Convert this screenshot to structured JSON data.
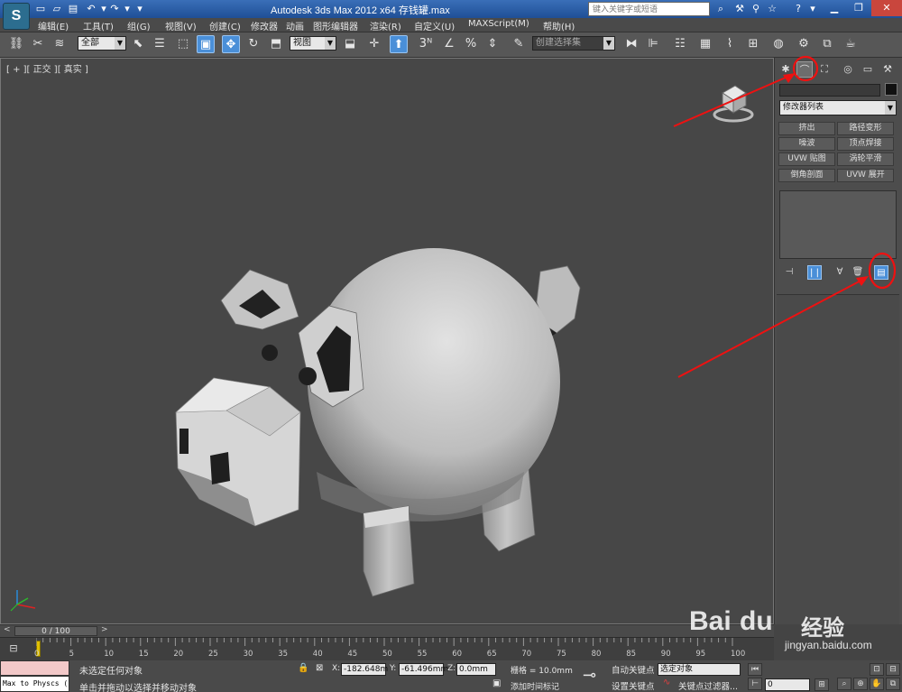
{
  "app": {
    "title": "Autodesk 3ds Max  2012 x64      存钱罐.max",
    "logo_letter": "S",
    "search_placeholder": "键入关键字或短语"
  },
  "menu": [
    "编辑(E)",
    "工具(T)",
    "组(G)",
    "视图(V)",
    "创建(C)",
    "修改器",
    "动画",
    "图形编辑器",
    "渲染(R)",
    "自定义(U)",
    "MAXScript(M)",
    "帮助(H)"
  ],
  "toolbar": {
    "selection_filter": "全部",
    "reference_coord": "视图",
    "named_selection": "创建选择集"
  },
  "viewport": {
    "label": "[ + ][ 正交 ][ 真实 ]"
  },
  "command_panel": {
    "modifier_list": "修改器列表",
    "modifier_buttons": [
      "挤出",
      "路径变形",
      "噪波",
      "顶点焊接",
      "UVW 贴图",
      "涡轮平滑",
      "倒角剖面",
      "UVW 展开"
    ]
  },
  "time": {
    "slider_label": "0 / 100",
    "ticks": [
      "0",
      "5",
      "10",
      "15",
      "20",
      "25",
      "30",
      "35",
      "40",
      "45",
      "50",
      "55",
      "60",
      "65",
      "70",
      "75",
      "80",
      "85",
      "90",
      "95",
      "100"
    ]
  },
  "status": {
    "maxscript_text": "Max to Physcs (",
    "selection_status": "未选定任何对象",
    "prompt": "单击并拖动以选择并移动对象",
    "x_label": "X:",
    "x_value": "-182.648m",
    "y_label": "Y:",
    "y_value": "-61.496mm",
    "z_label": "Z:",
    "z_value": "0.0mm",
    "grid": "栅格 = 10.0mm",
    "add_time_tag": "添加时间标记",
    "auto_key": "自动关键点",
    "set_key": "设置关键点",
    "selected_object": "选定对象",
    "key_filters": "关键点过滤器...",
    "frame": "0"
  },
  "watermark": {
    "brand_latin": "Bai",
    "brand_paw": "du",
    "brand_cn": "经验",
    "url": "jingyan.baidu.com"
  }
}
